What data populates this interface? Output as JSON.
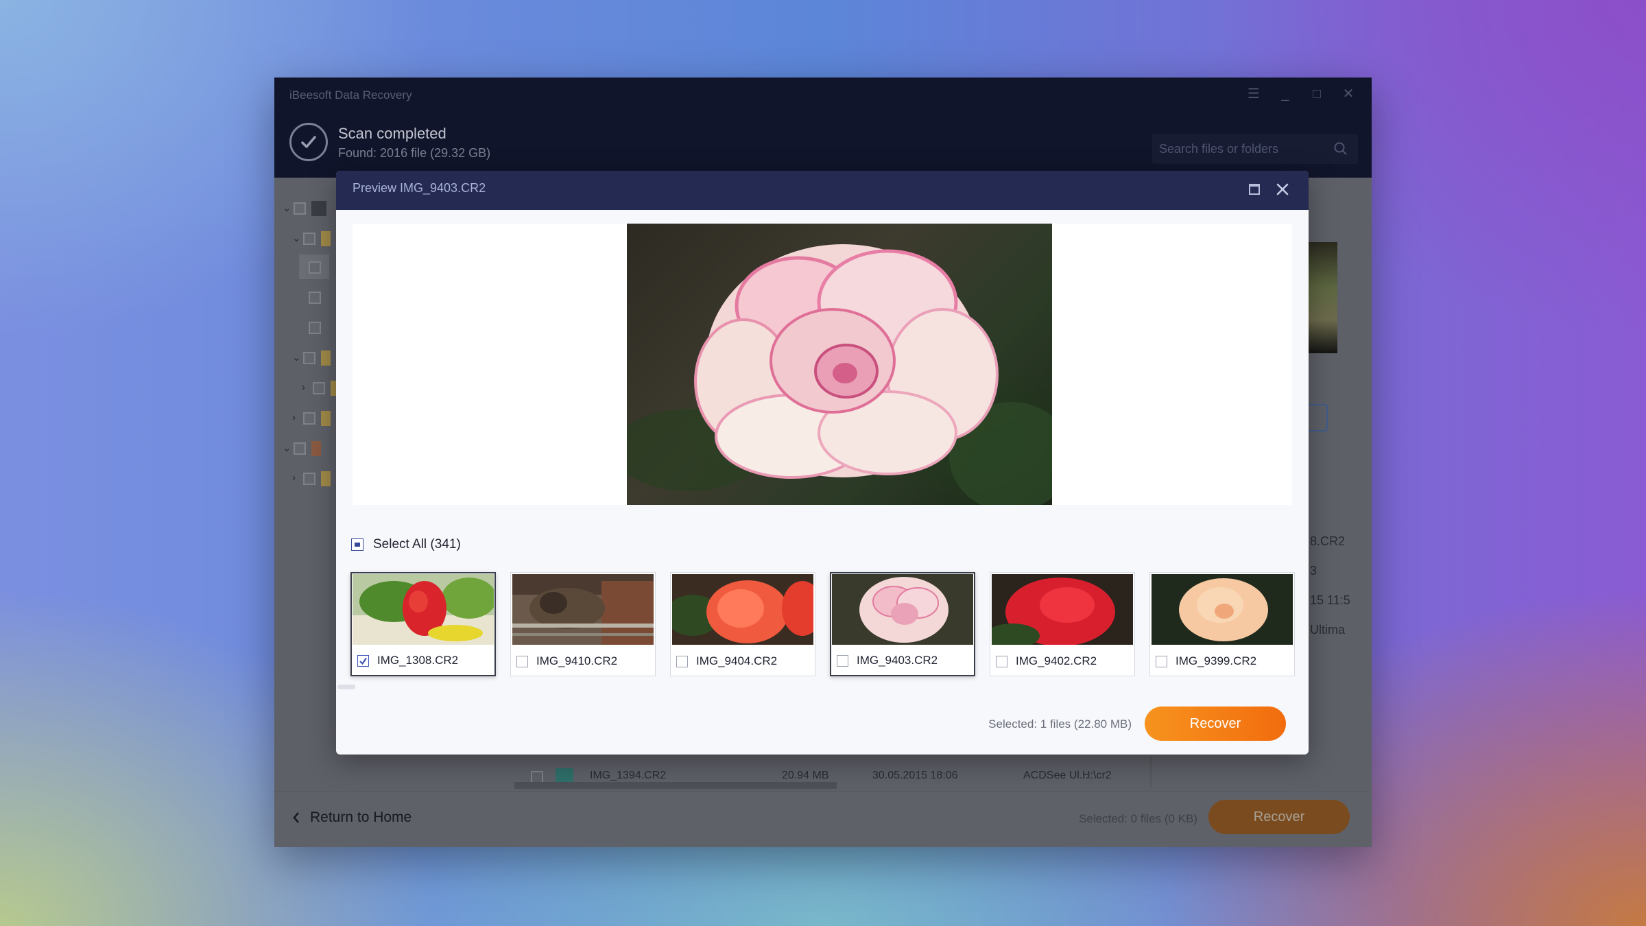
{
  "app": {
    "title": "iBeesoft Data Recovery",
    "scan_title": "Scan completed",
    "scan_subtitle": "Found: 2016 file (29.32 GB)",
    "search_placeholder": "Search files or folders"
  },
  "background": {
    "side_texts": [
      "8.CR2",
      "3",
      "15 11:5",
      "Ultima"
    ],
    "file_row": {
      "name": "IMG_1394.CR2",
      "size": "20.94 MB",
      "date": "30.05.2015 18:06",
      "app": "ACDSee Ul...",
      "path": "H:\\cr2"
    }
  },
  "footer": {
    "return_home": "Return to Home",
    "selected": "Selected: 0 files (0 KB)",
    "recover": "Recover"
  },
  "modal": {
    "title": "Preview IMG_9403.CR2",
    "select_all": "Select All (341)",
    "thumbnails": [
      {
        "name": "IMG_1308.CR2",
        "checked": true,
        "active": true
      },
      {
        "name": "IMG_9410.CR2",
        "checked": false,
        "active": false
      },
      {
        "name": "IMG_9404.CR2",
        "checked": false,
        "active": false
      },
      {
        "name": "IMG_9403.CR2",
        "checked": false,
        "active": true
      },
      {
        "name": "IMG_9402.CR2",
        "checked": false,
        "active": false
      },
      {
        "name": "IMG_9399.CR2",
        "checked": false,
        "active": false
      }
    ],
    "selected": "Selected: 1 files (22.80 MB)",
    "recover": "Recover"
  },
  "colors": {
    "header_navy": "#11152b",
    "modal_header": "#242a52",
    "accent_orange": "#f7931e",
    "checkbox_blue": "#3b52b8"
  }
}
